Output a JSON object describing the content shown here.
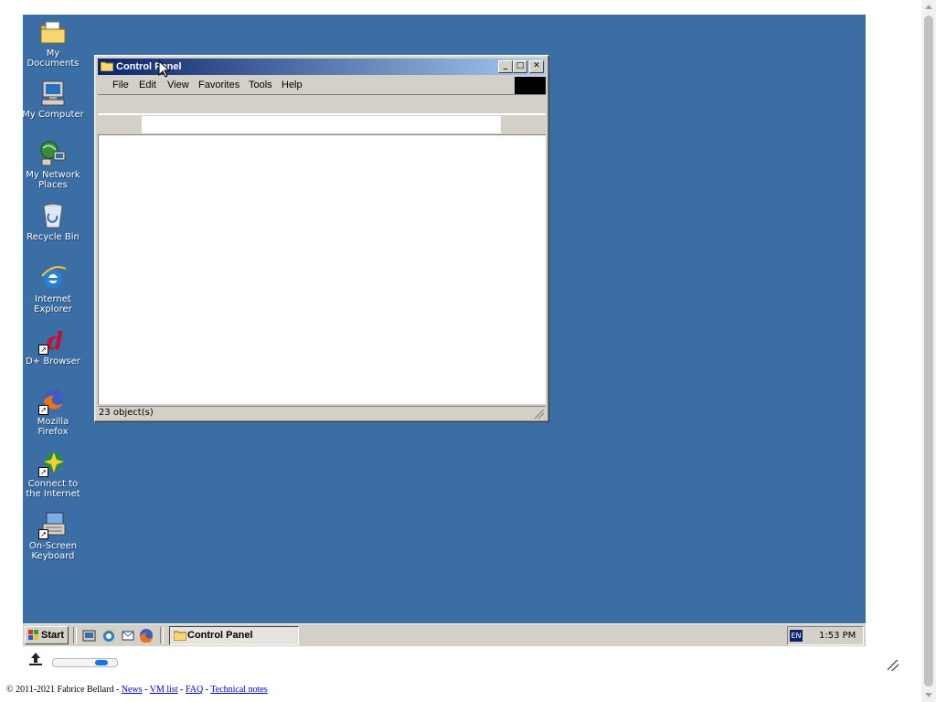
{
  "desktop": {
    "icons": [
      {
        "label": "My Documents",
        "icon": "folder-documents-icon"
      },
      {
        "label": "My Computer",
        "icon": "computer-icon"
      },
      {
        "label": "My Network Places",
        "icon": "network-icon"
      },
      {
        "label": "Recycle Bin",
        "icon": "recycle-bin-icon"
      },
      {
        "label": "Internet Explorer",
        "icon": "internet-explorer-icon"
      },
      {
        "label": "D+ Browser",
        "icon": "d-browser-icon"
      },
      {
        "label": "Mozilla Firefox",
        "icon": "firefox-icon"
      },
      {
        "label": "Connect to the Internet",
        "icon": "connect-internet-icon"
      },
      {
        "label": "On-Screen Keyboard",
        "icon": "keyboard-icon"
      }
    ]
  },
  "window": {
    "title": "Control Panel",
    "menu": [
      "File",
      "Edit",
      "View",
      "Favorites",
      "Tools",
      "Help"
    ],
    "status": "23 object(s)"
  },
  "taskbar": {
    "start_label": "Start",
    "task_label": "Control Panel",
    "lang": "EN",
    "clock": "1:53 PM"
  },
  "emulator": {
    "slider_fraction": 0.85
  },
  "footer": {
    "prefix": "© 2011-2021 Fabrice Bellard - ",
    "links": [
      "News",
      "VM list",
      "FAQ",
      "Technical notes"
    ],
    "separator": " - "
  },
  "colors": {
    "desktop": "#3a6ea5",
    "titlebar_start": "#0a246a",
    "titlebar_end": "#a6caf0",
    "face": "#d4d0c8"
  }
}
